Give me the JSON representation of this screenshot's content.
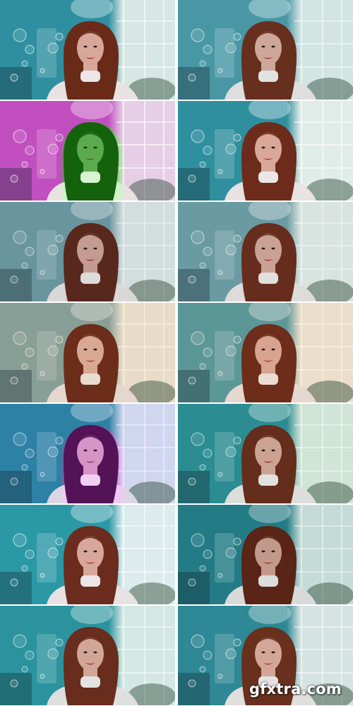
{
  "watermark": "gfxtra.com",
  "tiles": [
    {
      "name": "preset-1-teal",
      "wall": "#2f8fa0",
      "window": "#d6e7e4",
      "hair": "#6a2a18",
      "skin": "#d7a79a",
      "tint": "#ffffff",
      "hair_tint": null
    },
    {
      "name": "preset-2-cyan-soft",
      "wall": "#4c9aa8",
      "window": "#dde9e7",
      "hair": "#6c2f1d",
      "skin": "#d8aa9d",
      "tint": "#f4fbfb",
      "hair_tint": null
    },
    {
      "name": "preset-3-magenta",
      "wall": "#c24fc0",
      "window": "#e6cfe6",
      "hair": "#1f5a1c",
      "skin": "#64a357",
      "tint": "#ffffff",
      "hair_tint": "#2e8a21"
    },
    {
      "name": "preset-4-teal-warm",
      "wall": "#2f8f9e",
      "window": "#e0ece8",
      "hair": "#6d2c1b",
      "skin": "#d9a89a",
      "tint": "#ffffff",
      "hair_tint": null
    },
    {
      "name": "preset-5-grey-blue",
      "wall": "#6f9ca7",
      "window": "#e0e8e8",
      "hair": "#5e2a1e",
      "skin": "#cfa397",
      "tint": "#f0f3f3",
      "hair_tint": null
    },
    {
      "name": "preset-6-grey-teal",
      "wall": "#6f9fa8",
      "window": "#e3ece9",
      "hair": "#6a2e1f",
      "skin": "#d3a79b",
      "tint": "#f4f7f6",
      "hair_tint": null
    },
    {
      "name": "preset-7-warm-faded",
      "wall": "#8aa7a6",
      "window": "#ece7dc",
      "hair": "#6e2f1d",
      "skin": "#dcb0a2",
      "tint": "#fbf3e8",
      "hair_tint": null
    },
    {
      "name": "preset-8-warm-teal",
      "wall": "#5d9ea6",
      "window": "#eee8dd",
      "hair": "#6f2e1c",
      "skin": "#dbab9d",
      "tint": "#fcf4ea",
      "hair_tint": null
    },
    {
      "name": "preset-9-blue-violet",
      "wall": "#2f88a5",
      "window": "#dbe2ee",
      "hair": "#4d1a4e",
      "skin": "#d9a4aa",
      "tint": "#f2f2ff",
      "hair_tint": "#7a2a7c"
    },
    {
      "name": "preset-10-teal-green",
      "wall": "#2d8e97",
      "window": "#dce8df",
      "hair": "#6a2d1c",
      "skin": "#d6a698",
      "tint": "#f2fbf6",
      "hair_tint": null
    },
    {
      "name": "preset-11-turquoise",
      "wall": "#2b98a6",
      "window": "#dcebec",
      "hair": "#6b2c1d",
      "skin": "#d8a79b",
      "tint": "#ffffff",
      "hair_tint": null
    },
    {
      "name": "preset-12-deep-teal",
      "wall": "#257f8a",
      "window": "#d3e3e0",
      "hair": "#5f2618",
      "skin": "#d0a092",
      "tint": "#eef6f5",
      "hair_tint": null
    },
    {
      "name": "preset-13-aqua",
      "wall": "#2c95a0",
      "window": "#dcebe7",
      "hair": "#6c2d1c",
      "skin": "#d8a89a",
      "tint": "#f6fcfb",
      "hair_tint": null
    },
    {
      "name": "preset-14-teal-brown",
      "wall": "#2f8a98",
      "window": "#dbe7e6",
      "hair": "#6b301d",
      "skin": "#d8aa9b",
      "tint": "#f8fbfa",
      "hair_tint": null
    }
  ]
}
